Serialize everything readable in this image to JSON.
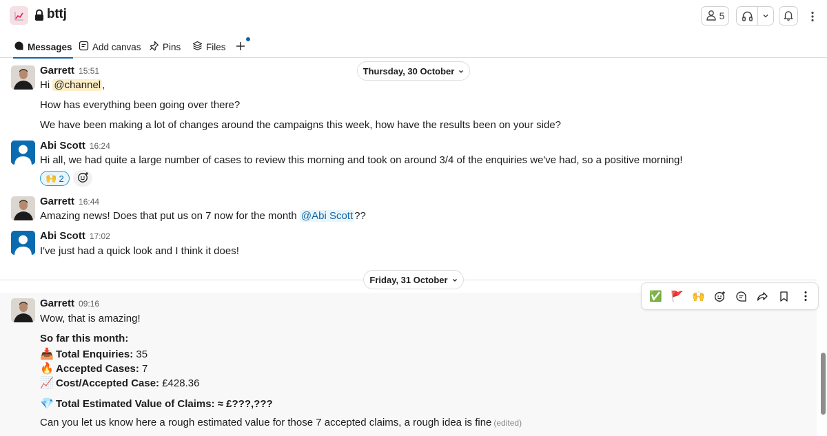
{
  "channel": {
    "name": "bttj",
    "icon": "chart-icon",
    "private": true
  },
  "header": {
    "members_count": "5",
    "tabs": [
      {
        "label": "Messages",
        "icon": "messages-icon",
        "active": true
      },
      {
        "label": "Add canvas",
        "icon": "canvas-icon"
      },
      {
        "label": "Pins",
        "icon": "pin-icon"
      },
      {
        "label": "Files",
        "icon": "files-icon"
      }
    ]
  },
  "dividers": {
    "day1": "Thursday, 30 October",
    "day2": "Friday, 31 October"
  },
  "messages": [
    {
      "sender": "Garrett",
      "time": "15:51",
      "greeting_prefix": "Hi ",
      "greeting_mention": "@channel",
      "greeting_suffix": ",",
      "line2": "How has everything been going over there?",
      "line3": "We have been making a lot of changes around the campaigns this week, how have the results been on your side?"
    },
    {
      "sender": "Abi Scott",
      "time": "16:24",
      "text": "Hi all, we had quite a large number of cases to review this morning and took on around 3/4 of the enquiries we've had, so a positive morning!",
      "reaction_emoji": "🙌",
      "reaction_count": "2"
    },
    {
      "sender": "Garrett",
      "time": "16:44",
      "text_prefix": "Amazing news! Does that put us on 7 now for the month ",
      "mention": "@Abi Scott",
      "text_suffix": "??"
    },
    {
      "sender": "Abi Scott",
      "time": "17:02",
      "text": "I've just had a quick look and I think it does!"
    },
    {
      "sender": "Garrett",
      "time": "09:16",
      "text": "Wow, that is amazing!",
      "heading": "So far this month:",
      "stats": [
        {
          "emoji": "📥",
          "label": "Total Enquiries:",
          "value": " 35"
        },
        {
          "emoji": "🔥",
          "label": "Accepted Cases:",
          "value": " 7"
        },
        {
          "emoji": "📈",
          "label": "Cost/Accepted Case:",
          "value": " £428.36"
        }
      ],
      "estimate_emoji": "💎",
      "estimate": "Total Estimated Value of Claims: ≈ £???,???",
      "closing": "Can you let us know here a rough estimated value for those 7 accepted claims, a rough idea is fine",
      "edited": "(edited)"
    }
  ],
  "toolbar": {
    "items": [
      "check-emoji",
      "flag-emoji",
      "raised-hands-emoji",
      "add-reaction-icon",
      "reply-thread-icon",
      "forward-icon",
      "bookmark-icon",
      "more-actions-icon"
    ],
    "emoji_check": "✅",
    "emoji_flag": "🚩",
    "emoji_hands": "🙌"
  },
  "colors": {
    "accent": "#1264a3",
    "mention_bg": "#fcefc7",
    "reaction_border": "#1d9bd1"
  }
}
